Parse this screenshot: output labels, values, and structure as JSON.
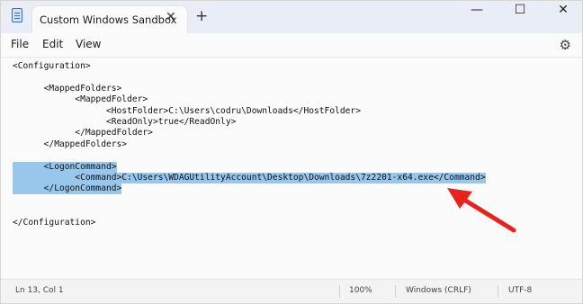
{
  "window": {
    "tab_title": "Custom Windows Sandbox",
    "new_tab_symbol": "+",
    "close_tab_symbol": "✕",
    "minimize_symbol": "—",
    "maximize_symbol": "☐",
    "close_symbol": "✕"
  },
  "menu": {
    "file": "File",
    "edit": "Edit",
    "view": "View"
  },
  "editor": {
    "lines": [
      "<Configuration>",
      "",
      "      <MappedFolders>",
      "            <MappedFolder>",
      "                  <HostFolder>C:\\Users\\codru\\Downloads</HostFolder>",
      "                  <ReadOnly>true</ReadOnly>",
      "            </MappedFolder>",
      "      </MappedFolders>",
      "",
      "      <LogonCommand>",
      "            <Command>C:\\Users\\WDAGUtilityAccount\\Desktop\\Downloads\\7z2201-x64.exe</Command>",
      "      </LogonCommand>",
      "",
      "",
      "</Configuration>"
    ],
    "selected_lines": [
      9,
      10,
      11
    ]
  },
  "status": {
    "position": "Ln 13, Col 1",
    "zoom": "100%",
    "line_endings": "Windows (CRLF)",
    "encoding": "UTF-8"
  },
  "colors": {
    "selection": "#99c6eb",
    "arrow": "#e8231c"
  }
}
